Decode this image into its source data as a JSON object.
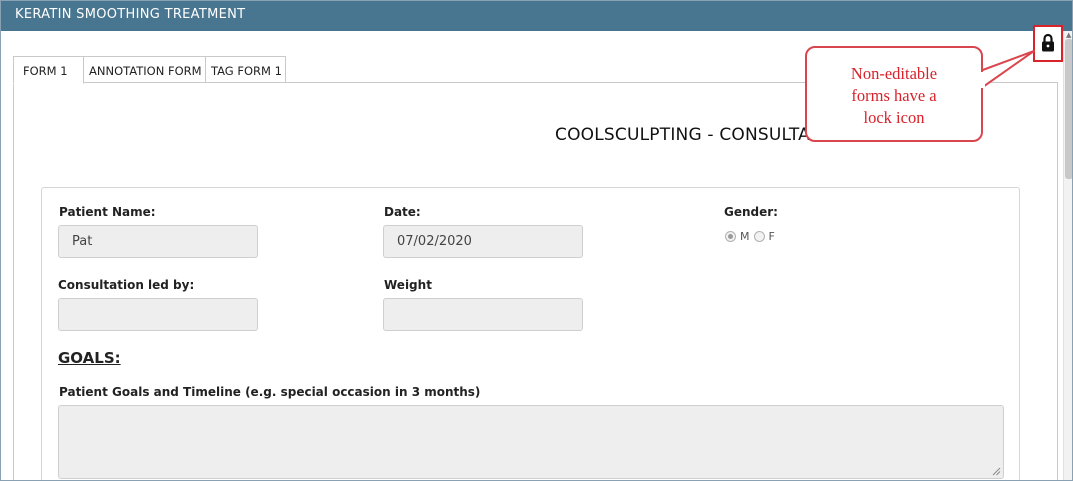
{
  "window": {
    "title": "KERATIN SMOOTHING TREATMENT"
  },
  "tabs": [
    {
      "label": "FORM 1",
      "active": true
    },
    {
      "label": "ANNOTATION FORM",
      "active": false
    },
    {
      "label": "TAG FORM 1",
      "active": false
    }
  ],
  "lock": {
    "icon": "lock-icon",
    "color": "#d9222a"
  },
  "form": {
    "title": "COOLSCULPTING - CONSULTATION FORM",
    "patient_name": {
      "label": "Patient Name:",
      "value": "Pat"
    },
    "date": {
      "label": "Date:",
      "value": "07/02/2020"
    },
    "gender": {
      "label": "Gender:",
      "options": [
        {
          "label": "M",
          "checked": true
        },
        {
          "label": "F",
          "checked": false
        }
      ]
    },
    "consultation_led_by": {
      "label": "Consultation led by:",
      "value": ""
    },
    "weight": {
      "label": "Weight",
      "value": ""
    },
    "goals": {
      "heading": "GOALS:",
      "timeline_label": "Patient Goals and Timeline (e.g. special occasion in 3 months)",
      "timeline_value": ""
    }
  },
  "callout": {
    "line1": "Non-editable",
    "line2": "forms have a",
    "line3": "lock icon",
    "color": "#d9222a"
  },
  "colors": {
    "titlebar": "#48758f",
    "field_bg": "#eeeeee"
  }
}
